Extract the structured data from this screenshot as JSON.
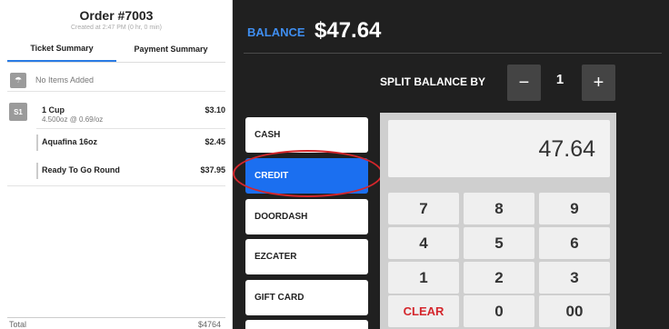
{
  "order": {
    "title": "Order #7003",
    "subtitle": "Created at 2:47 PM (0 hr, 0 min)",
    "tabs": [
      {
        "label": "Ticket Summary",
        "active": true
      },
      {
        "label": "Payment Summary",
        "active": false
      }
    ],
    "no_items_label": "No Items Added",
    "seat_label": "S1",
    "items": [
      {
        "name": "1 Cup",
        "modifier": "4.500oz @ 0.69/oz",
        "price": "$3.10"
      },
      {
        "name": "Aquafina 16oz",
        "price": "$2.45"
      },
      {
        "name": "Ready To Go Round",
        "price": "$37.95"
      }
    ],
    "total_label": "Total",
    "total_value": "$4764"
  },
  "payment": {
    "balance_label": "BALANCE",
    "balance_value": "$47.64",
    "split_label": "SPLIT BALANCE BY",
    "split_minus": "−",
    "split_value": "1",
    "split_plus": "+",
    "methods": [
      {
        "label": "CASH",
        "selected": false
      },
      {
        "label": "CREDIT",
        "selected": true
      },
      {
        "label": "DOORDASH",
        "selected": false
      },
      {
        "label": "EZCATER",
        "selected": false
      },
      {
        "label": "GIFT CARD",
        "selected": false
      }
    ],
    "display_value": "47.64",
    "keys": [
      "7",
      "8",
      "9",
      "4",
      "5",
      "6",
      "1",
      "2",
      "3",
      "CLEAR",
      "0",
      "00"
    ]
  },
  "colors": {
    "accent_blue": "#1b6ff0",
    "balance_blue": "#3f8ef0",
    "highlight_red": "#d4262c",
    "panel_dark": "#202020"
  }
}
